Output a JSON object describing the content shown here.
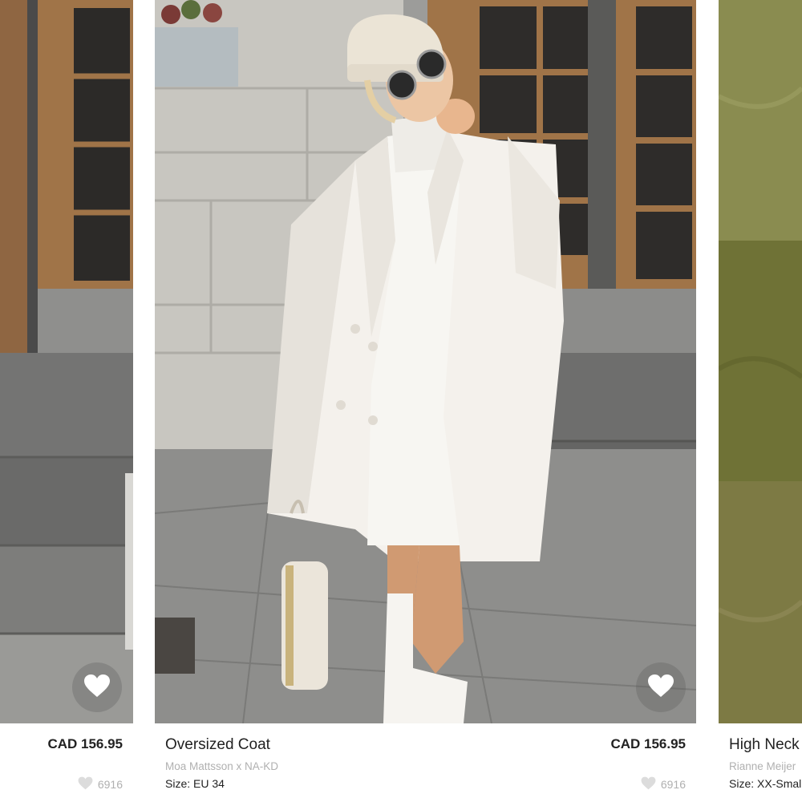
{
  "products": [
    {
      "title": "",
      "brand": "",
      "size": "",
      "price": "CAD 156.95",
      "likes": "6916",
      "icons": {
        "favorite": "heart-icon",
        "likes": "heart-outline-icon"
      }
    },
    {
      "title": "Oversized Coat",
      "brand": "Moa Mattsson x NA-KD",
      "size": "Size: EU 34",
      "price": "CAD 156.95",
      "likes": "6916",
      "icons": {
        "favorite": "heart-icon",
        "likes": "heart-outline-icon"
      }
    },
    {
      "title": "High Neck",
      "brand": "Rianne Meijer",
      "size": "Size: XX-Small",
      "price": "",
      "likes": "",
      "icons": {
        "favorite": "heart-icon",
        "likes": "heart-outline-icon"
      }
    }
  ],
  "colors": {
    "price_text": "#222222",
    "muted_text": "#b0b0b0",
    "favorite_fill": "#ffffff",
    "coat": "#f4f1ec",
    "door_wood": "#9a7148",
    "pavement": "#8e8e8c",
    "grass": "#7a7c3e"
  }
}
